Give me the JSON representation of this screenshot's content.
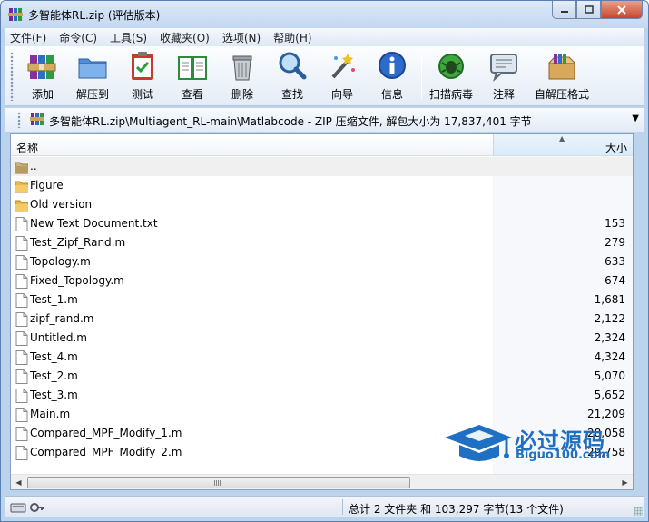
{
  "window": {
    "title": "多智能体RL.zip (评估版本)"
  },
  "menu": [
    "文件(F)",
    "命令(C)",
    "工具(S)",
    "收藏夹(O)",
    "选项(N)",
    "帮助(H)"
  ],
  "toolbar": {
    "buttons": [
      {
        "label": "添加",
        "icon": "add-books-icon"
      },
      {
        "label": "解压到",
        "icon": "extract-folder-icon"
      },
      {
        "label": "测试",
        "icon": "test-clipboard-icon"
      },
      {
        "label": "查看",
        "icon": "view-book-icon"
      },
      {
        "label": "删除",
        "icon": "delete-trash-icon"
      },
      {
        "label": "查找",
        "icon": "find-magnifier-icon"
      },
      {
        "label": "向导",
        "icon": "wizard-wand-icon"
      },
      {
        "label": "信息",
        "icon": "info-icon"
      },
      {
        "label": "扫描病毒",
        "icon": "virus-scan-icon"
      },
      {
        "label": "注释",
        "icon": "comment-icon"
      },
      {
        "label": "自解压格式",
        "icon": "sfx-box-icon"
      }
    ]
  },
  "address": {
    "path": "多智能体RL.zip\\Multiagent_RL-main\\Matlabcode - ZIP 压缩文件, 解包大小为 17,837,401 字节"
  },
  "list": {
    "columns": {
      "name": "名称",
      "size": "大小"
    },
    "rows": [
      {
        "name": "..",
        "size": "",
        "type": "parent"
      },
      {
        "name": "Figure",
        "size": "",
        "type": "folder"
      },
      {
        "name": "Old version",
        "size": "",
        "type": "folder"
      },
      {
        "name": "New Text Document.txt",
        "size": "153",
        "type": "file"
      },
      {
        "name": "Test_Zipf_Rand.m",
        "size": "279",
        "type": "file"
      },
      {
        "name": "Topology.m",
        "size": "633",
        "type": "file"
      },
      {
        "name": "Fixed_Topology.m",
        "size": "674",
        "type": "file"
      },
      {
        "name": "Test_1.m",
        "size": "1,681",
        "type": "file"
      },
      {
        "name": "zipf_rand.m",
        "size": "2,122",
        "type": "file"
      },
      {
        "name": "Untitled.m",
        "size": "2,324",
        "type": "file"
      },
      {
        "name": "Test_4.m",
        "size": "4,324",
        "type": "file"
      },
      {
        "name": "Test_2.m",
        "size": "5,070",
        "type": "file"
      },
      {
        "name": "Test_3.m",
        "size": "5,652",
        "type": "file"
      },
      {
        "name": "Main.m",
        "size": "21,209",
        "type": "file"
      },
      {
        "name": "Compared_MPF_Modify_1.m",
        "size": "28,058",
        "type": "file"
      },
      {
        "name": "Compared_MPF_Modify_2.m",
        "size": "29,758",
        "type": "file"
      }
    ]
  },
  "watermark": {
    "title": "必过源码",
    "url": "Biguo100.com"
  },
  "status": {
    "summary": "总计 2 文件夹 和 103,297 字节(13 个文件)"
  },
  "colors": {
    "accent": "#1f6fc2",
    "frame": "#bcd3ee"
  }
}
